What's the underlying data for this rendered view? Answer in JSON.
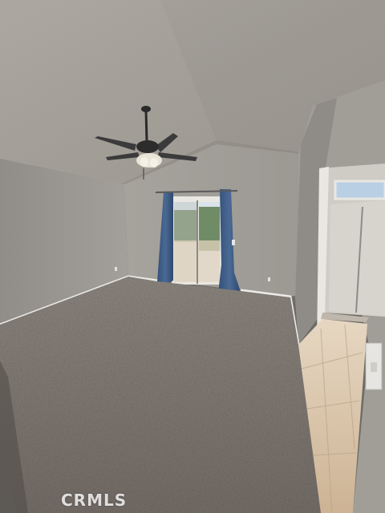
{
  "photo": {
    "watermark": "CRMLS",
    "palette": {
      "ceiling": "#9a968f",
      "walls": "#9c9993",
      "carpet": "#7d7670",
      "tile": "#d8c3a6",
      "curtain": "#3f5d86",
      "window_glass": "#d9e3ec",
      "trim": "#e9e7e2"
    }
  }
}
